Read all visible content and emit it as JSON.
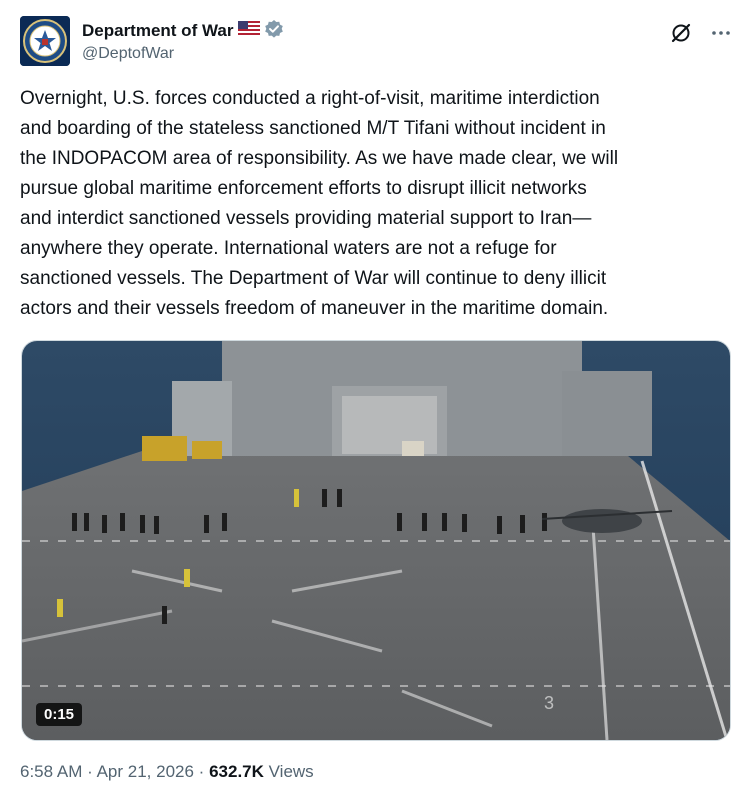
{
  "author": {
    "display_name": "Department of War",
    "handle": "@DeptofWar",
    "avatar_icon": "seal-icon",
    "flag_icon": "us-flag-icon",
    "verified_icon": "verified-badge-icon",
    "verified_color": "#829aab"
  },
  "tweet": {
    "text": "Overnight, U.S. forces conducted a right-of-visit, maritime interdiction\nand boarding of the stateless sanctioned M/T Tifani without incident in\nthe INDOPACOM area of responsibility.  As we have made clear, we will\npursue global maritime enforcement efforts to disrupt illicit networks\nand interdict sanctioned vessels providing material support to Iran—\nanywhere they operate.  International waters are not a refuge for\nsanctioned vessels. The Department of War will continue to deny illicit\nactors and their vessels freedom of maneuver in the maritime domain."
  },
  "media": {
    "type": "video",
    "duration": "0:15"
  },
  "meta": {
    "time": "6:58 AM",
    "separator": "·",
    "date": "Apr 21, 2026",
    "views_count": "632.7K",
    "views_label": "Views"
  },
  "actions": {
    "grok_icon": "grok-icon",
    "more_icon": "more-icon"
  }
}
